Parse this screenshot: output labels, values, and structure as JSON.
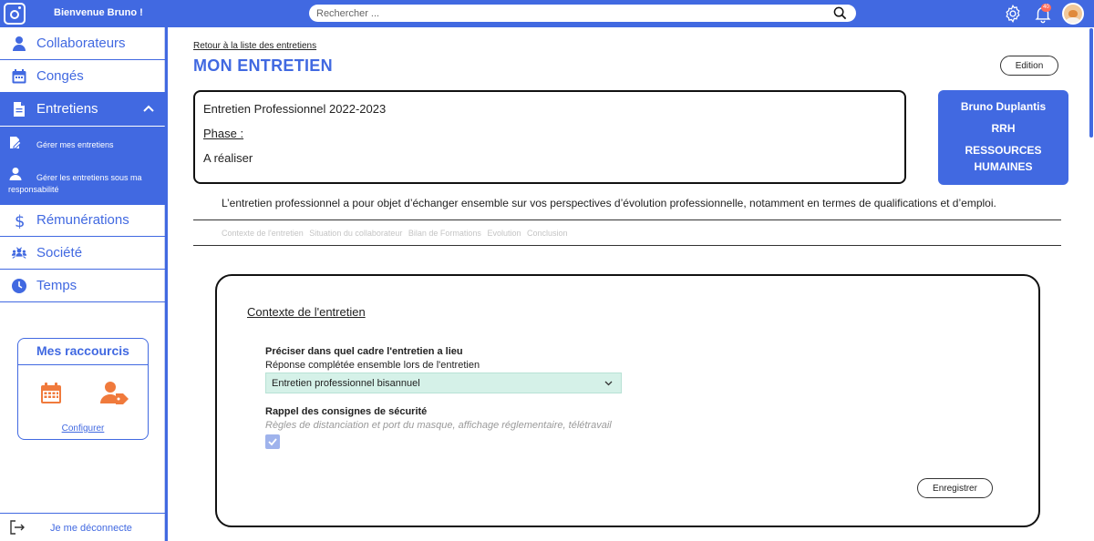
{
  "topbar": {
    "welcome": "Bienvenue Bruno !",
    "search_placeholder": "Rechercher ...",
    "notification_count": "40",
    "icons": [
      "app-logo-icon",
      "search-icon",
      "gear-icon",
      "bell-icon",
      "user-avatar"
    ]
  },
  "sidebar": {
    "items": [
      {
        "label": "Collaborateurs",
        "icon": "user-icon"
      },
      {
        "label": "Congés",
        "icon": "calendar-icon"
      },
      {
        "label": "Entretiens",
        "icon": "document-icon",
        "active": true
      },
      {
        "label": "Rémunérations",
        "icon": "dollar-icon"
      },
      {
        "label": "Société",
        "icon": "team-icon"
      },
      {
        "label": "Temps",
        "icon": "clock-icon"
      }
    ],
    "subitems": [
      {
        "label": "Gérer mes entretiens"
      },
      {
        "label": "Gérer les entretiens sous ma responsabilité"
      }
    ],
    "shortcuts": {
      "title": "Mes raccourcis",
      "configure": "Configurer",
      "icons": [
        "calendar-shortcut-icon",
        "user-tag-shortcut-icon"
      ]
    },
    "logout": "Je me déconnecte"
  },
  "main": {
    "back_link": "Retour à la liste des entretiens",
    "title": "MON ENTRETIEN",
    "edit_button": "Edition",
    "info": {
      "name": "Entretien Professionnel 2022-2023",
      "phase_label": "Phase :",
      "phase_value": "A réaliser"
    },
    "user_card": {
      "name": "Bruno Duplantis",
      "role": "RRH",
      "department_line1": "RESSOURCES",
      "department_line2": "HUMAINES"
    },
    "intro": "L’entretien professionnel a pour objet d’échanger ensemble sur vos perspectives d’évolution professionnelle, notamment en termes de qualifications et d’emploi.",
    "steps": [
      "Contexte de l'entretien",
      "Situation du collaborateur",
      "Bilan de Formations",
      "Evolution",
      "Conclusion"
    ],
    "form": {
      "section_title": "Contexte de l'entretien",
      "q1_label": "Préciser dans quel cadre l'entretien a lieu",
      "q1_hint": "Réponse complétée ensemble lors de l'entretien",
      "q1_value": "Entretien professionnel bisannuel",
      "q2_label": "Rappel des consignes de sécurité",
      "q2_hint": "Règles de distanciation et port du masque, affichage réglementaire, télétravail",
      "q2_checked": true,
      "save_button": "Enregistrer"
    }
  },
  "colors": {
    "primary": "#4169e1",
    "accent_orange": "#f07a3c",
    "select_bg": "#d5f1e8",
    "check_bg": "#9fb3ec"
  }
}
